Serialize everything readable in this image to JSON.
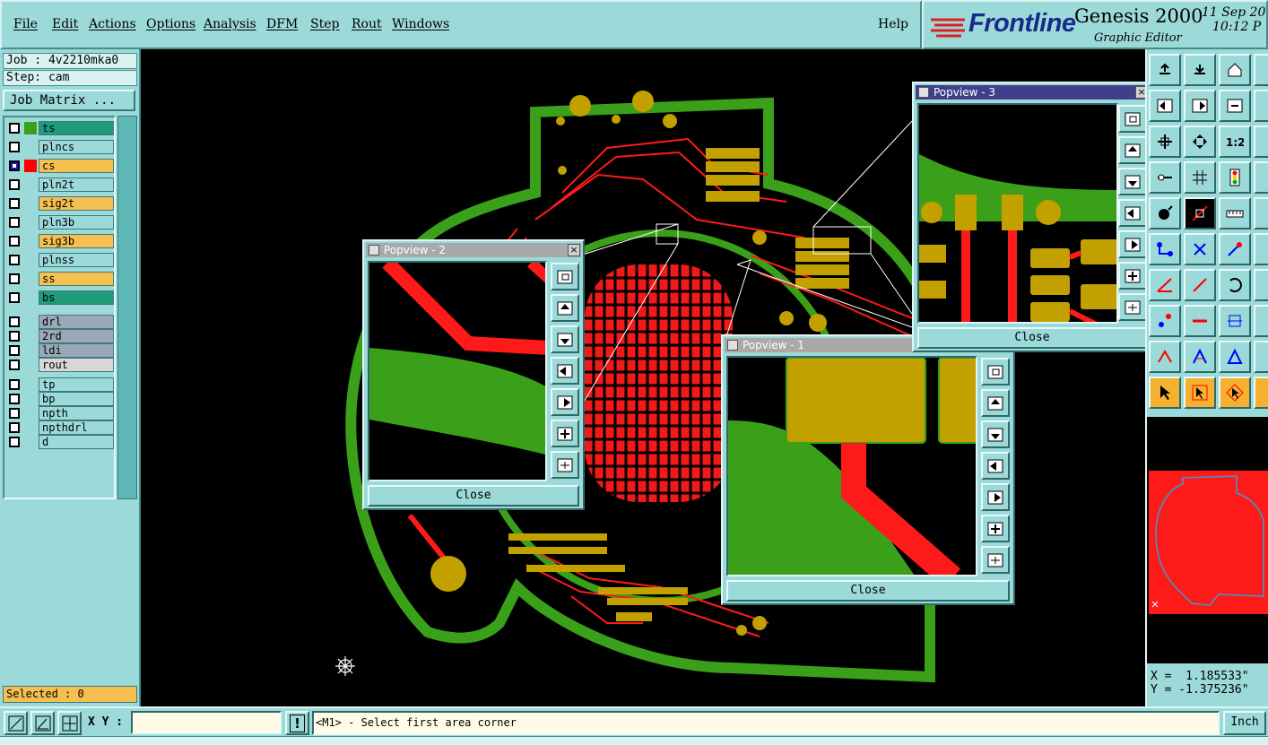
{
  "menubar": {
    "items": [
      "File",
      "Edit",
      "Actions",
      "Options",
      "Analysis",
      "DFM",
      "Step",
      "Rout",
      "Windows"
    ],
    "help": "Help"
  },
  "brand": {
    "logo": "Frontline",
    "product": "Genesis 2000",
    "subtitle": "Graphic Editor",
    "date": "11 Sep 20",
    "time": "10:12 P"
  },
  "left": {
    "job": "Job : 4v2210mka0",
    "step": "Step: cam",
    "job_matrix": "Job Matrix ...",
    "selected": "Selected : 0",
    "layers": [
      {
        "name": "ts",
        "bg": "#1f9a7a",
        "swatch": "#3aa01a",
        "checked": false
      },
      {
        "name": "plncs",
        "bg": "#9cd9d9",
        "swatch": "",
        "checked": false
      },
      {
        "name": "cs",
        "bg": "#f5c050",
        "swatch": "#ff0000",
        "checked": true
      },
      {
        "name": "pln2t",
        "bg": "#9cd9d9",
        "swatch": "",
        "checked": false
      },
      {
        "name": "sig2t",
        "bg": "#f5c050",
        "swatch": "",
        "checked": false
      },
      {
        "name": "pln3b",
        "bg": "#9cd9d9",
        "swatch": "",
        "checked": false
      },
      {
        "name": "sig3b",
        "bg": "#f5c050",
        "swatch": "",
        "checked": false
      },
      {
        "name": "plnss",
        "bg": "#9cd9d9",
        "swatch": "",
        "checked": false
      },
      {
        "name": "ss",
        "bg": "#f5c050",
        "swatch": "",
        "checked": false
      },
      {
        "name": "bs",
        "bg": "#1f9a7a",
        "swatch": "",
        "checked": false
      },
      {
        "name": "drl",
        "bg": "#9aa8b8",
        "swatch": "",
        "checked": false
      },
      {
        "name": "2rd",
        "bg": "#9aa8b8",
        "swatch": "",
        "checked": false
      },
      {
        "name": "ldi",
        "bg": "#9aa8b8",
        "swatch": "",
        "checked": false
      },
      {
        "name": "rout",
        "bg": "#d8d8d8",
        "swatch": "",
        "checked": false
      },
      {
        "name": "tp",
        "bg": "#9cd9d9",
        "swatch": "",
        "checked": false
      },
      {
        "name": "bp",
        "bg": "#9cd9d9",
        "swatch": "",
        "checked": false
      },
      {
        "name": "npth",
        "bg": "#9cd9d9",
        "swatch": "",
        "checked": false
      },
      {
        "name": "npthdrl",
        "bg": "#9cd9d9",
        "swatch": "",
        "checked": false
      },
      {
        "name": "d",
        "bg": "#9cd9d9",
        "swatch": "",
        "checked": false
      }
    ]
  },
  "popviews": [
    {
      "title": "Popview - 2",
      "close": "Close"
    },
    {
      "title": "Popview - 1",
      "close": "Close"
    },
    {
      "title": "Popview - 3",
      "close": "Close"
    }
  ],
  "right": {
    "ratio_label": "1:2",
    "coords": {
      "x": "X =  1.185533\"",
      "y": "Y = -1.375236\""
    }
  },
  "bottom": {
    "xy_label": "X Y :",
    "xy_value": "",
    "alert": "!",
    "message": "<M1> - Select first area corner",
    "units": "Inch"
  },
  "colors": {
    "panel": "#9cd9d9",
    "copper": "#ff1a1a",
    "soldermask": "#3aa01a",
    "pad": "#c2a000",
    "active_title": "#3f3f8c"
  }
}
